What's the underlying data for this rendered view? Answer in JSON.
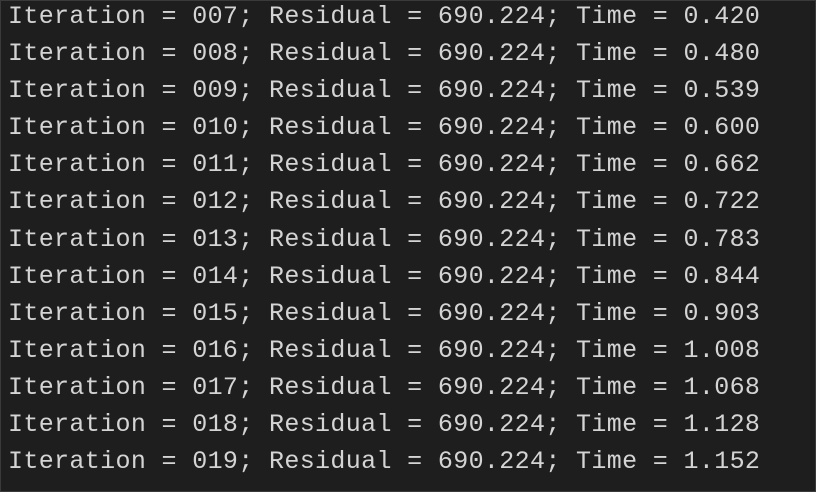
{
  "console": {
    "lines": [
      "Iteration = 007; Residual = 690.224; Time = 0.420",
      "Iteration = 008; Residual = 690.224; Time = 0.480",
      "Iteration = 009; Residual = 690.224; Time = 0.539",
      "Iteration = 010; Residual = 690.224; Time = 0.600",
      "Iteration = 011; Residual = 690.224; Time = 0.662",
      "Iteration = 012; Residual = 690.224; Time = 0.722",
      "Iteration = 013; Residual = 690.224; Time = 0.783",
      "Iteration = 014; Residual = 690.224; Time = 0.844",
      "Iteration = 015; Residual = 690.224; Time = 0.903",
      "Iteration = 016; Residual = 690.224; Time = 1.008",
      "Iteration = 017; Residual = 690.224; Time = 1.068",
      "Iteration = 018; Residual = 690.224; Time = 1.128",
      "Iteration = 019; Residual = 690.224; Time = 1.152"
    ]
  },
  "colors": {
    "background": "#1e1e1e",
    "text": "#d4d4d4"
  }
}
